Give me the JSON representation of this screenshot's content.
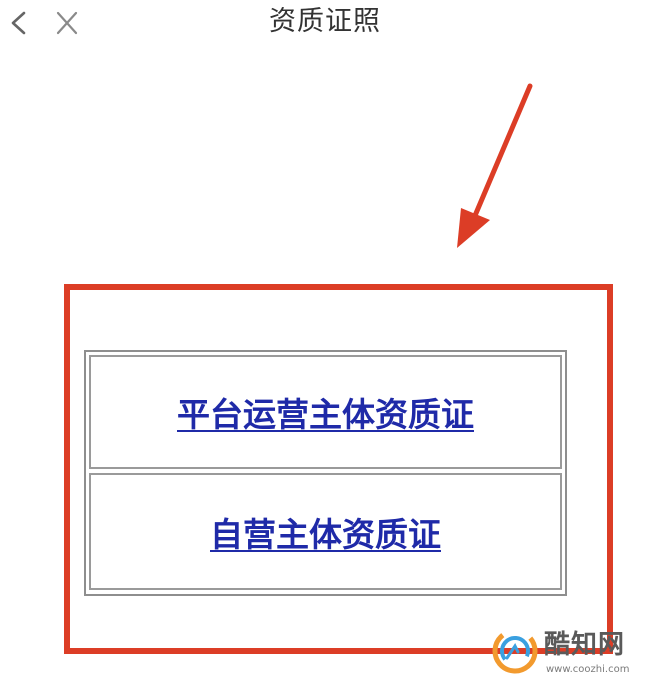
{
  "nav": {
    "back_icon": "chevron-left-icon",
    "close_icon": "close-icon",
    "title": "资质证照"
  },
  "links": [
    {
      "label": "平台运营主体资质证"
    },
    {
      "label": "自营主体资质证"
    }
  ],
  "annotation": {
    "arrow_color": "#dc3d26",
    "frame_color": "#dc3d26"
  },
  "watermark": {
    "name": "酷知网",
    "url": "www.coozhi.com"
  },
  "colors": {
    "link": "#1f2aa8",
    "title": "#333333",
    "icon": "#666666"
  }
}
